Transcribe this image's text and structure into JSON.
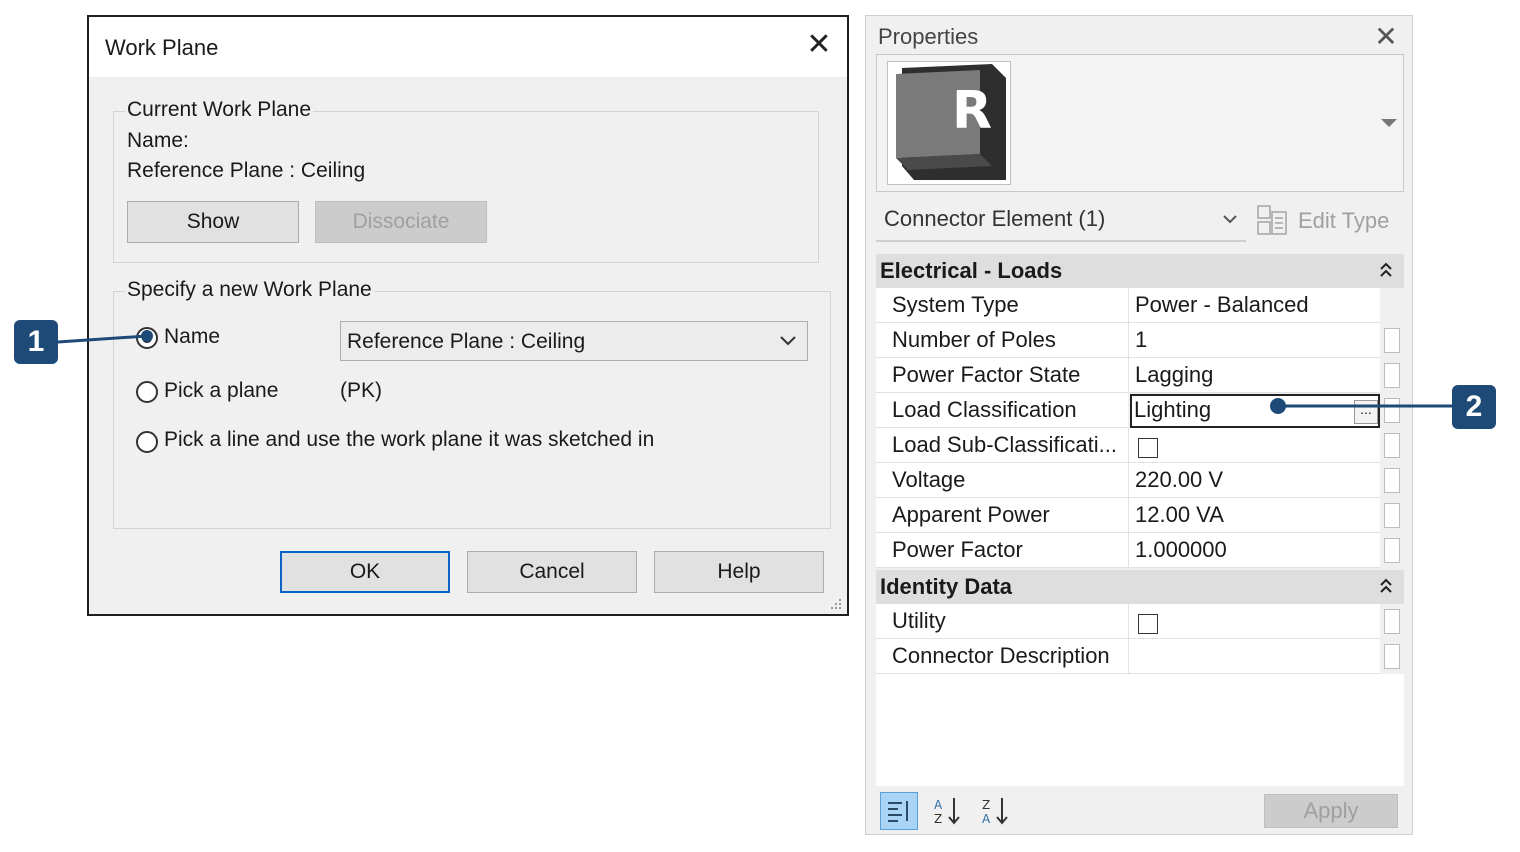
{
  "workplane_dialog": {
    "title": "Work Plane",
    "current_group": {
      "legend": "Current Work Plane",
      "name_label": "Name:",
      "name_value": "Reference Plane : Ceiling",
      "show_label": "Show",
      "dissociate_label": "Dissociate"
    },
    "specify_group": {
      "legend": "Specify a new Work Plane",
      "option_name": "Name",
      "name_select_value": "Reference Plane : Ceiling",
      "option_pick_plane": "Pick a plane",
      "pick_plane_shortcut": "(PK)",
      "option_pick_line": "Pick a line and use the work plane it was sketched in"
    },
    "buttons": {
      "ok": "OK",
      "cancel": "Cancel",
      "help": "Help"
    }
  },
  "properties": {
    "title": "Properties",
    "type_selector": "Connector Element (1)",
    "edit_type": "Edit Type",
    "sections": [
      {
        "title": "Electrical - Loads",
        "rows": [
          {
            "label": "System Type",
            "value": "Power - Balanced"
          },
          {
            "label": "Number of Poles",
            "value": "1"
          },
          {
            "label": "Power Factor State",
            "value": "Lagging"
          },
          {
            "label": "Load Classification",
            "value": "Lighting"
          },
          {
            "label": "Load Sub-Classificati...",
            "value": ""
          },
          {
            "label": "Voltage",
            "value": "220.00 V"
          },
          {
            "label": "Apparent Power",
            "value": "12.00 VA"
          },
          {
            "label": "Power Factor",
            "value": "1.000000"
          }
        ]
      },
      {
        "title": "Identity Data",
        "rows": [
          {
            "label": "Utility",
            "value": ""
          },
          {
            "label": "Connector Description",
            "value": ""
          }
        ]
      }
    ],
    "apply_label": "Apply",
    "ellipsis": "..."
  },
  "callouts": {
    "one": "1",
    "two": "2"
  },
  "colors": {
    "callout": "#1e4a78",
    "default_button_border": "#0a64c8"
  }
}
